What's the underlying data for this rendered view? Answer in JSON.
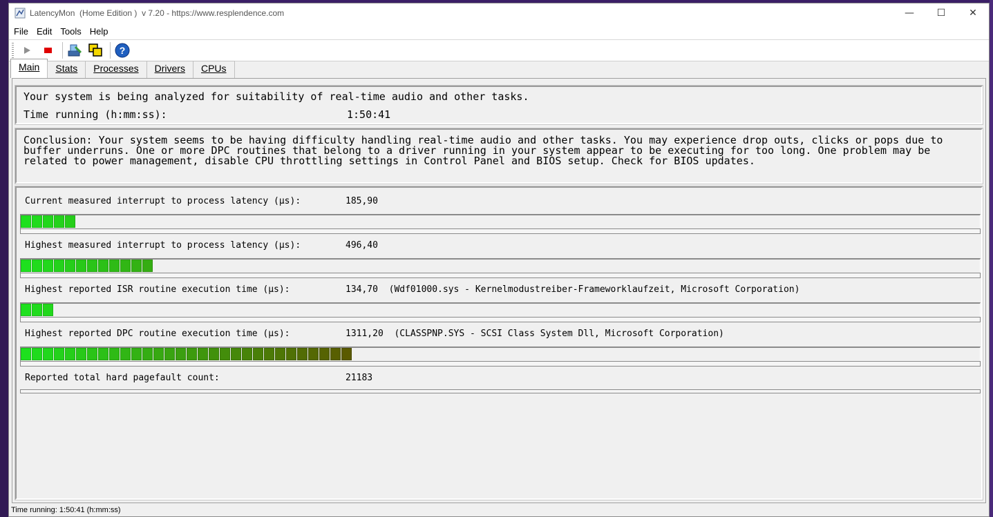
{
  "window": {
    "title": "LatencyMon  (Home Edition )  v 7.20 - https://www.resplendence.com",
    "minimize_glyph": "—",
    "maximize_glyph": "☐",
    "close_glyph": "✕"
  },
  "menu": {
    "file": "File",
    "edit": "Edit",
    "tools": "Tools",
    "help": "Help"
  },
  "toolbar": {
    "icons": [
      "play-icon",
      "stop-icon",
      "drivers-icon",
      "windows-icon",
      "help-icon"
    ],
    "colors": {
      "stop": "#e00000",
      "play": "#808080"
    }
  },
  "tabs": {
    "main": "Main",
    "stats": "Stats",
    "processes": "Processes",
    "drivers": "Drivers",
    "cpus": "CPUs"
  },
  "summary": {
    "analyzing": "Your system is being analyzed for suitability of real-time audio and other tasks.",
    "time_label": "Time running (h:mm:ss):",
    "time_value": "1:50:41"
  },
  "conclusion": "Conclusion: Your system seems to be having difficulty handling real-time audio and other tasks. You may experience drop outs, clicks or pops due to buffer underruns. One or more DPC routines that belong to a driver running in your system appear to be executing for too long. One problem may be related to power management, disable CPU throttling settings in Control Panel and BIOS setup. Check for BIOS updates.",
  "metrics": {
    "current": {
      "label": "Current measured interrupt to process latency (µs):",
      "value": "185,90",
      "segments": 5
    },
    "highest": {
      "label": "Highest measured interrupt to process latency (µs):",
      "value": "496,40",
      "segments": 12
    },
    "isr": {
      "label": "Highest reported ISR routine execution time (µs):",
      "value": "134,70  (Wdf01000.sys - Kernelmodustreiber-Frameworklaufzeit, Microsoft Corporation)",
      "segments": 3
    },
    "dpc": {
      "label": "Highest reported DPC routine execution time (µs):",
      "value": "1311,20  (CLASSPNP.SYS - SCSI Class System Dll, Microsoft Corporation)",
      "segments": 30
    },
    "pagefault": {
      "label": "Reported total hard pagefault count:",
      "value": "21183"
    }
  },
  "bar_colors": {
    "start": "#1ee01e",
    "end": "#5a5a00"
  },
  "statusbar": "Time running: 1:50:41  (h:mm:ss)"
}
